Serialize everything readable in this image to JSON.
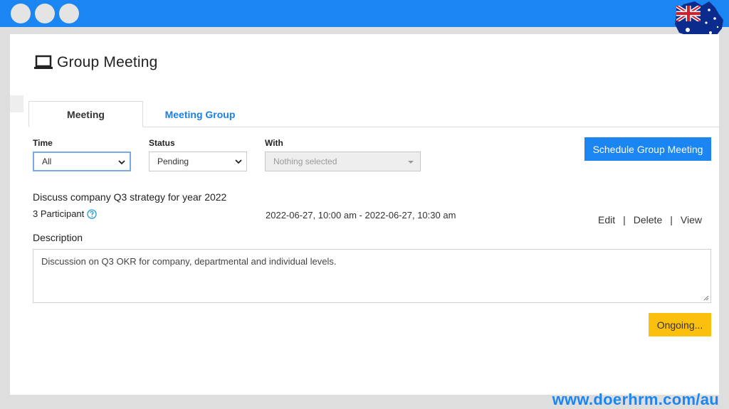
{
  "window": {
    "dots": [
      "close",
      "minimize",
      "maximize"
    ],
    "accent_color": "#1b86f2"
  },
  "header": {
    "title": "Group Meeting",
    "icon": "laptop-icon"
  },
  "tabs": [
    {
      "label": "Meeting",
      "active": true
    },
    {
      "label": "Meeting Group",
      "active": false
    }
  ],
  "filters": {
    "time": {
      "label": "Time",
      "value": "All"
    },
    "status": {
      "label": "Status",
      "value": "Pending"
    },
    "with": {
      "label": "With",
      "placeholder": "Nothing selected"
    }
  },
  "schedule_button": {
    "label": "Schedule Group Meeting",
    "color": "#1b86f2"
  },
  "meeting": {
    "title": "Discuss company Q3 strategy for year 2022",
    "participants": "3 Participant",
    "datetime": "2022-06-27, 10:00 am - 2022-06-27, 10:30 am",
    "actions": {
      "edit": "Edit",
      "delete": "Delete",
      "view": "View",
      "separator": "|"
    },
    "description_label": "Description",
    "description": "Discussion on Q3 OKR for company, departmental and individual levels.",
    "status_button": {
      "label": "Ongoing...",
      "color": "#fbbf0e"
    }
  },
  "branding": {
    "url": "www.doerhrm.com/au",
    "flag": "australia-flag"
  }
}
